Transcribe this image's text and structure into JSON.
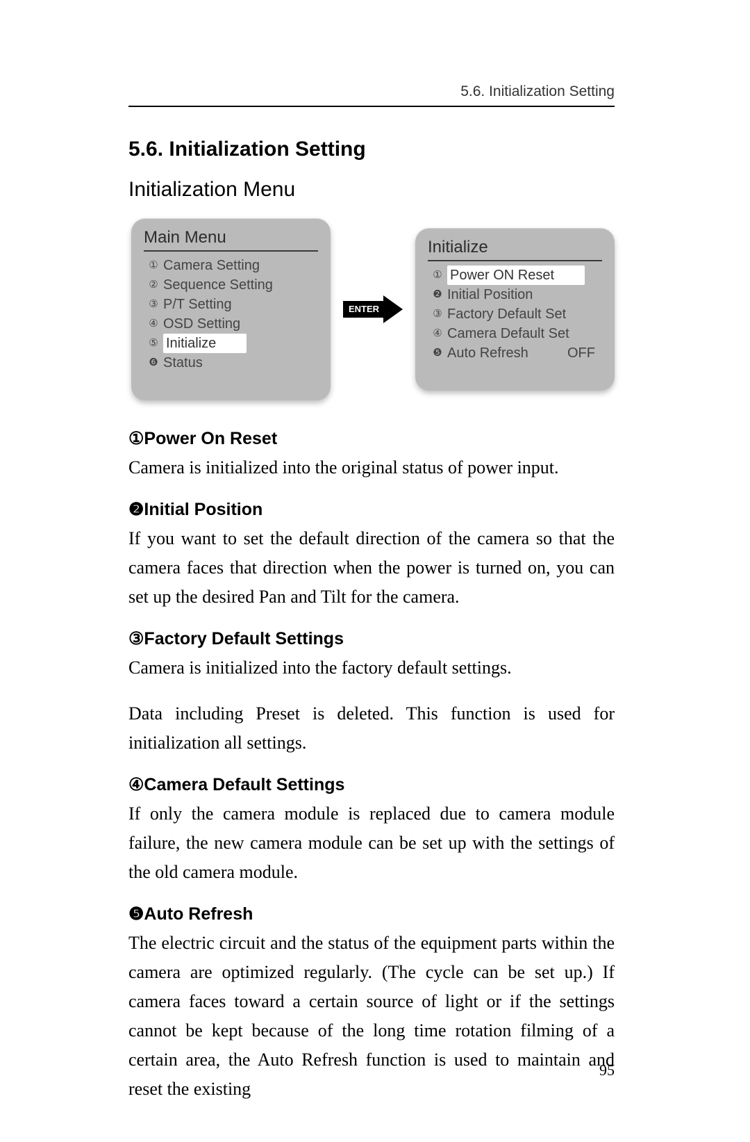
{
  "header": {
    "label": "5.6. Initialization Setting",
    "page_number": "95"
  },
  "section": {
    "title": "5.6. Initialization Setting",
    "subtitle": "Initialization Menu"
  },
  "menu_left": {
    "title": "Main Menu",
    "items": [
      {
        "marker": "①",
        "label": "Camera Setting",
        "highlight": false
      },
      {
        "marker": "②",
        "label": "Sequence Setting",
        "highlight": false
      },
      {
        "marker": "③",
        "label": "P/T Setting",
        "highlight": false
      },
      {
        "marker": "④",
        "label": "OSD Setting",
        "highlight": false
      },
      {
        "marker": "⑤",
        "label": "Initialize",
        "highlight": true
      },
      {
        "marker": "❻",
        "label": "Status",
        "highlight": false
      }
    ]
  },
  "enter_label": "ENTER",
  "menu_right": {
    "title": "Initialize",
    "items": [
      {
        "marker": "①",
        "label": "Power ON Reset",
        "highlight": true
      },
      {
        "marker": "❷",
        "label": "Initial Position",
        "highlight": false
      },
      {
        "marker": "③",
        "label": "Factory Default Set",
        "highlight": false
      },
      {
        "marker": "④",
        "label": "Camera Default Set",
        "highlight": false
      },
      {
        "marker": "❺",
        "label": "Auto Refresh",
        "right": "OFF",
        "highlight": false
      }
    ]
  },
  "sections": [
    {
      "heading_marker": "①",
      "heading": "Power On Reset",
      "paragraphs": [
        "Camera is initialized into the original status of power input."
      ],
      "justify": false
    },
    {
      "heading_marker": "❷",
      "heading": "Initial Position",
      "paragraphs": [
        "If you want to set the default direction of the camera so that the camera faces that direction when the power is turned on, you can set up the desired Pan and Tilt for the camera."
      ],
      "justify": true
    },
    {
      "heading_marker": "③",
      "heading": "Factory Default Settings",
      "paragraphs": [
        "Camera is initialized into the factory default settings.",
        "Data including Preset is deleted. This function is used for initialization all settings."
      ],
      "justify": true
    },
    {
      "heading_marker": "④",
      "heading": "Camera Default Settings",
      "paragraphs": [
        "If only the camera module is replaced due to camera module failure, the new camera module can be set up with the settings of the old camera module."
      ],
      "justify": true
    },
    {
      "heading_marker": "❺",
      "heading": "Auto Refresh",
      "paragraphs": [
        "The electric circuit and the status of the equipment parts within the camera are optimized regularly. (The cycle can be set up.) If camera faces toward a certain source of light or if the settings cannot be kept because of the long time rotation filming of a certain area, the Auto Refresh function is used to maintain and reset the existing"
      ],
      "justify": true
    }
  ]
}
